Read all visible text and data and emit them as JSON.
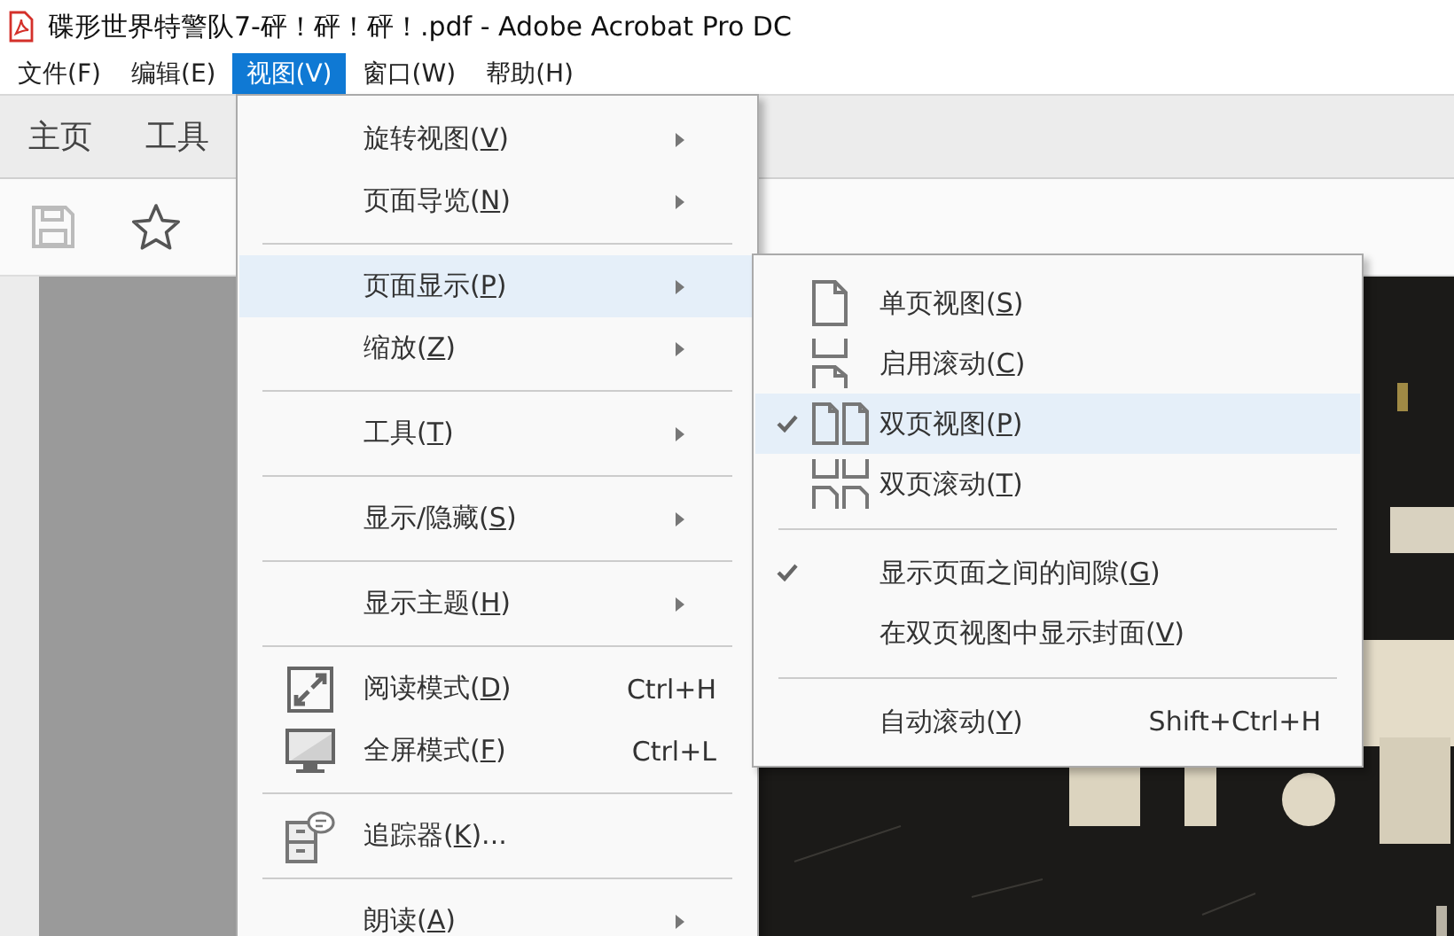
{
  "window": {
    "title": "碟形世界特警队7-砰！砰！砰！.pdf - Adobe Acrobat Pro DC"
  },
  "menubar": [
    {
      "label": "文件(F)",
      "selected": false
    },
    {
      "label": "编辑(E)",
      "selected": false
    },
    {
      "label": "视图(V)",
      "selected": true
    },
    {
      "label": "窗口(W)",
      "selected": false
    },
    {
      "label": "帮助(H)",
      "selected": false
    }
  ],
  "tabs": [
    {
      "label": "主页"
    },
    {
      "label": "工具"
    }
  ],
  "view_menu": {
    "groups": [
      [
        {
          "label": "旋转视图(V)",
          "submenu": true,
          "selected": false
        },
        {
          "label": "页面导览(N)",
          "submenu": true,
          "selected": false
        }
      ],
      [
        {
          "label": "页面显示(P)",
          "submenu": true,
          "selected": true
        },
        {
          "label": "缩放(Z)",
          "submenu": true,
          "selected": false
        }
      ],
      [
        {
          "label": "工具(T)",
          "submenu": true,
          "selected": false
        }
      ],
      [
        {
          "label": "显示/隐藏(S)",
          "submenu": true,
          "selected": false
        }
      ],
      [
        {
          "label": "显示主题(H)",
          "submenu": true,
          "selected": false
        }
      ],
      [
        {
          "label": "阅读模式(D)",
          "shortcut": "Ctrl+H",
          "submenu": false,
          "selected": false
        },
        {
          "label": "全屏模式(F)",
          "shortcut": "Ctrl+L",
          "submenu": false,
          "selected": false
        }
      ],
      [
        {
          "label": "追踪器(K)...",
          "submenu": false,
          "selected": false
        }
      ],
      [
        {
          "label": "朗读(A)",
          "submenu": true,
          "selected": false
        }
      ]
    ]
  },
  "page_display_menu": {
    "groups": [
      [
        {
          "label": "单页视图(S)",
          "checked": false,
          "selected": false
        },
        {
          "label": "启用滚动(C)",
          "checked": false,
          "selected": false
        },
        {
          "label": "双页视图(P)",
          "checked": true,
          "selected": true
        },
        {
          "label": "双页滚动(T)",
          "checked": false,
          "selected": false
        }
      ],
      [
        {
          "label": "显示页面之间的间隙(G)",
          "checked": true,
          "selected": false
        },
        {
          "label": "在双页视图中显示封面(V)",
          "checked": false,
          "selected": false
        }
      ],
      [
        {
          "label": "自动滚动(Y)",
          "shortcut": "Shift+Ctrl+H",
          "checked": false,
          "selected": false
        }
      ]
    ]
  }
}
